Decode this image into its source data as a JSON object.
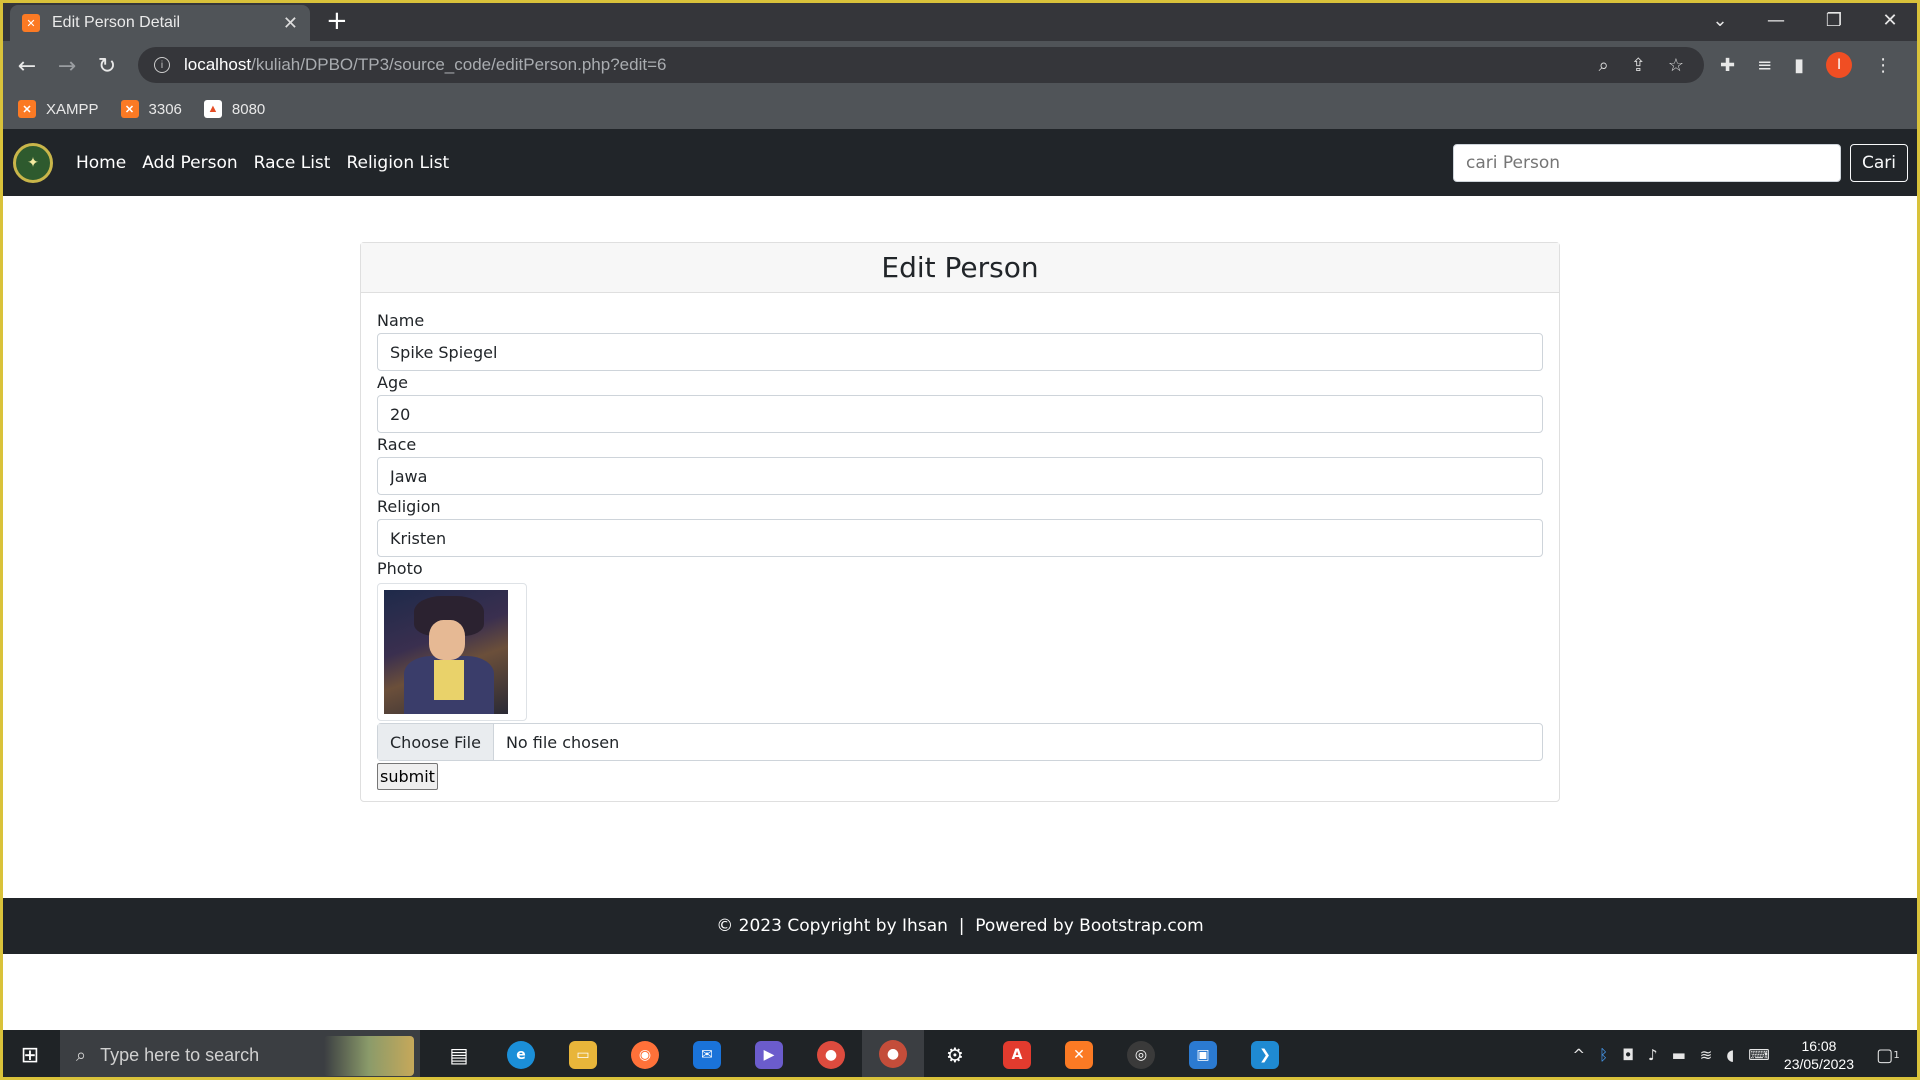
{
  "browser": {
    "tab_title": "Edit Person Detail",
    "url_host": "localhost",
    "url_path": "/kuliah/DPBO/TP3/source_code/editPerson.php?edit=6",
    "profile_initial": "I",
    "bookmarks": [
      {
        "label": "XAMPP",
        "icon": "xampp-icon"
      },
      {
        "label": "3306",
        "icon": "xampp-icon"
      },
      {
        "label": "8080",
        "icon": "fire-icon"
      }
    ]
  },
  "navbar": {
    "links": [
      "Home",
      "Add Person",
      "Race List",
      "Religion List"
    ],
    "search_placeholder": "cari Person",
    "search_button": "Cari"
  },
  "form": {
    "title": "Edit Person",
    "name_label": "Name",
    "name_value": "Spike Spiegel",
    "age_label": "Age",
    "age_value": "20",
    "race_label": "Race",
    "race_value": "Jawa",
    "religion_label": "Religion",
    "religion_value": "Kristen",
    "photo_label": "Photo",
    "file_button": "Choose File",
    "file_status": "No file chosen",
    "submit_label": "submit"
  },
  "footer": {
    "text": "© 2023 Copyright by Ihsan  |  Powered by Bootstrap.com"
  },
  "taskbar": {
    "search_placeholder": "Type here to search",
    "time": "16:08",
    "date": "23/05/2023",
    "notification_count": "1"
  }
}
